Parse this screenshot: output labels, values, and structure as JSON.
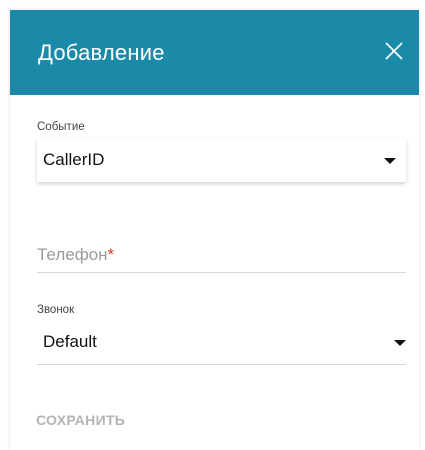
{
  "dialog": {
    "title": "Добавление",
    "close_icon": "close-icon"
  },
  "form": {
    "event": {
      "label": "Событие",
      "value": "CallerID"
    },
    "phone": {
      "placeholder": "Телефон",
      "required_mark": "*",
      "value": ""
    },
    "ring": {
      "label": "Звонок",
      "value": "Default"
    }
  },
  "actions": {
    "save_label": "СОХРАНИТЬ"
  },
  "colors": {
    "header_bg": "#1b8aa8",
    "required": "#e5342b",
    "disabled_text": "#b4b4b4"
  }
}
